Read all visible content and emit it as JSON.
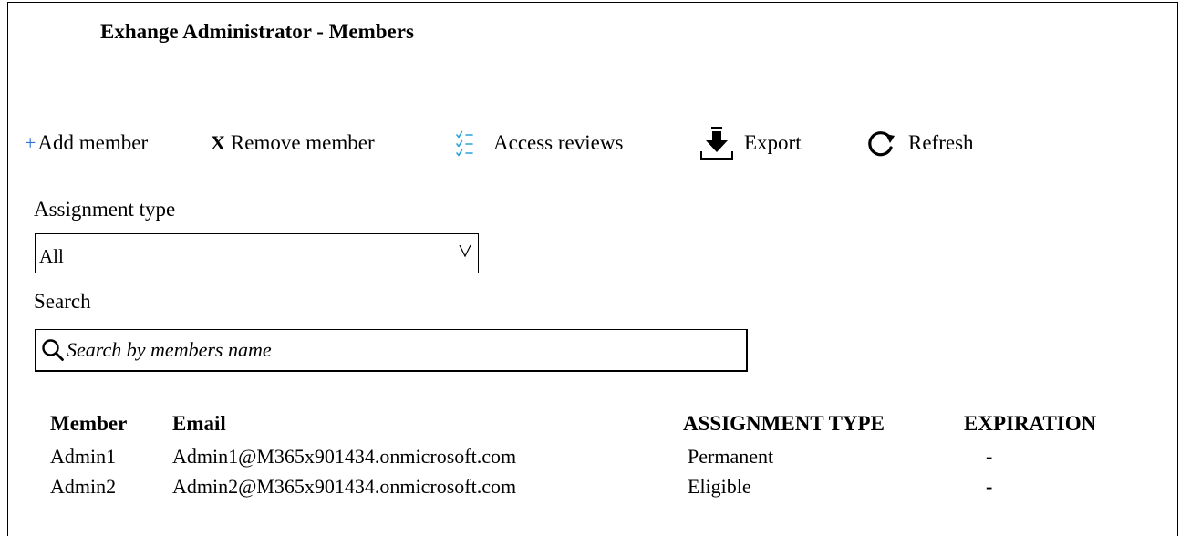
{
  "window": {
    "title": "Exhange Administrator - Members"
  },
  "toolbar": {
    "add_label": "Add member",
    "add_glyph": "+",
    "remove_label": "Remove member",
    "remove_glyph": "X",
    "access_reviews_label": "Access reviews",
    "export_label": "Export",
    "refresh_label": "Refresh",
    "icons": {
      "add": "plus-icon",
      "remove": "x-icon",
      "access_reviews": "checklist-icon",
      "export": "download-icon",
      "refresh": "refresh-icon"
    },
    "accent_color": "#2b73d6",
    "checklist_color": "#2aa3d9"
  },
  "filters": {
    "assignment_type_label": "Assignment type",
    "assignment_type_value": "All",
    "search_label": "Search",
    "search_placeholder": "Search by members name"
  },
  "table": {
    "columns": [
      "Member",
      "Email",
      "ASSIGNMENT TYPE",
      "EXPIRATION"
    ],
    "rows": [
      {
        "member": "Admin1",
        "email": "Admin1@M365x901434.onmicrosoft.com",
        "assignment_type": "Permanent",
        "expiration": "-"
      },
      {
        "member": "Admin2",
        "email": "Admin2@M365x901434.onmicrosoft.com",
        "assignment_type": "Eligible",
        "expiration": "-"
      }
    ]
  }
}
